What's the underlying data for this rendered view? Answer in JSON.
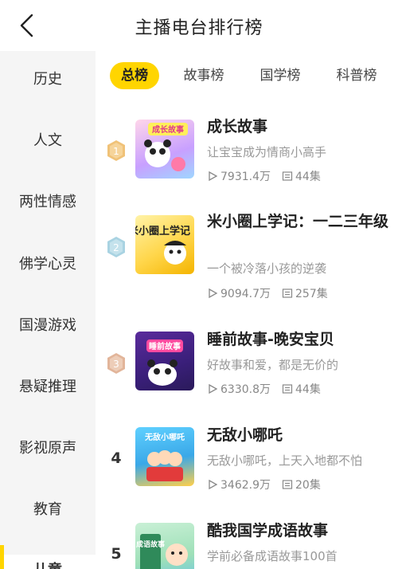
{
  "header": {
    "title": "主播电台排行榜"
  },
  "sidebar": {
    "items": [
      {
        "label": "历史"
      },
      {
        "label": "人文"
      },
      {
        "label": "两性情感"
      },
      {
        "label": "佛学心灵"
      },
      {
        "label": "国漫游戏"
      },
      {
        "label": "悬疑推理"
      },
      {
        "label": "影视原声"
      },
      {
        "label": "教育"
      },
      {
        "label": "儿童"
      }
    ]
  },
  "tabs": [
    {
      "label": "总榜",
      "active": true
    },
    {
      "label": "故事榜"
    },
    {
      "label": "国学榜"
    },
    {
      "label": "科普榜"
    }
  ],
  "list": [
    {
      "rank": "1",
      "title": "成长故事",
      "desc": "让宝宝成为情商小高手",
      "plays": "7931.4万",
      "episodes": "44集",
      "cover_text": "成长故事"
    },
    {
      "rank": "2",
      "title": "米小圈上学记：一二三年级",
      "desc": "一个被冷落小孩的逆袭",
      "plays": "9094.7万",
      "episodes": "257集",
      "cover_text": "米小圈上学记"
    },
    {
      "rank": "3",
      "title": "睡前故事-晚安宝贝",
      "desc": "好故事和爱，都是无价的",
      "plays": "6330.8万",
      "episodes": "44集",
      "cover_text": "睡前故事"
    },
    {
      "rank": "4",
      "title": "无敌小哪吒",
      "desc": "无敌小哪吒，上天入地都不怕",
      "plays": "3462.9万",
      "episodes": "20集",
      "cover_text": "无敌小哪吒"
    },
    {
      "rank": "5",
      "title": "酷我国学成语故事",
      "desc": "学前必备成语故事100首",
      "plays": "",
      "episodes": "",
      "cover_text": "成语故事"
    }
  ],
  "colors": {
    "accent": "#ffd500",
    "gold": "#e6b04a",
    "silver": "#9fc6d6",
    "bronze": "#d9a98a"
  },
  "icons": {
    "back": "chevron-left-icon",
    "play": "play-icon",
    "episodes": "episode-list-icon"
  }
}
